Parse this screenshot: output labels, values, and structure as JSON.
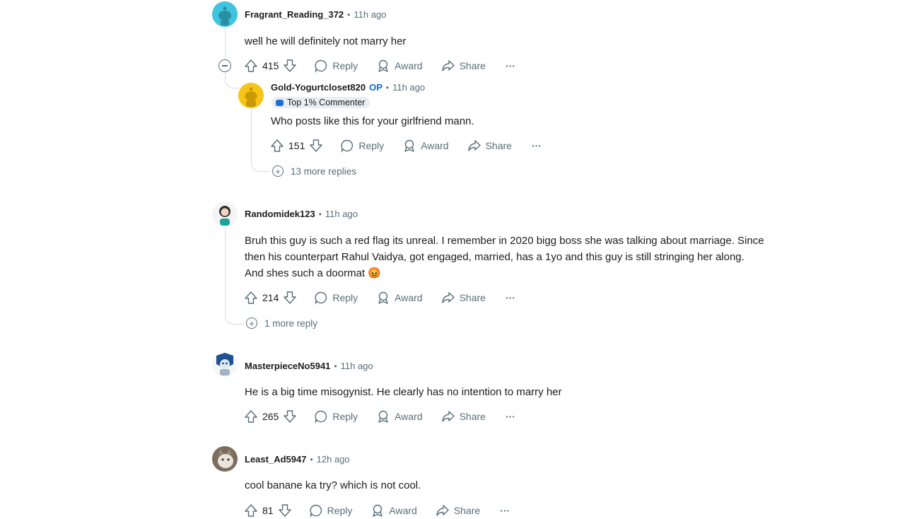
{
  "comments": [
    {
      "author": "Fragrant_Reading_372",
      "time": "11h ago",
      "body": "well he will definitely not marry her",
      "score": "415",
      "avatar_color": "#3ec4de"
    },
    {
      "author": "Gold-Yogurtcloset820",
      "op": "OP",
      "flair": "Top 1% Commenter",
      "time": "11h ago",
      "body": "Who posts like this for your girlfriend mann.",
      "score": "151",
      "more_replies": "13 more replies",
      "avatar_color": "#f5c518"
    },
    {
      "author": "Randomidek123",
      "time": "11h ago",
      "body_lines": [
        "Bruh this guy is such a red flag its unreal. I remember in 2020 bigg boss she was talking about marriage. Since",
        "then his counterpart Rahul Vaidya, got engaged, married, has a 1yo and this guy is still stringing her along.",
        "And shes such a doormat"
      ],
      "emoji": "😡",
      "score": "214",
      "more_replies": "1 more reply"
    },
    {
      "author": "MasterpieceNo5941",
      "time": "11h ago",
      "body": "He is a big time misogynist. He clearly has no intention to marry her",
      "score": "265"
    },
    {
      "author": "Least_Ad5947",
      "time": "12h ago",
      "body": "cool banane ka try? which is not cool.",
      "score": "81"
    }
  ],
  "actions": {
    "reply": "Reply",
    "award": "Award",
    "share": "Share",
    "overflow": "···"
  },
  "separator": "•"
}
